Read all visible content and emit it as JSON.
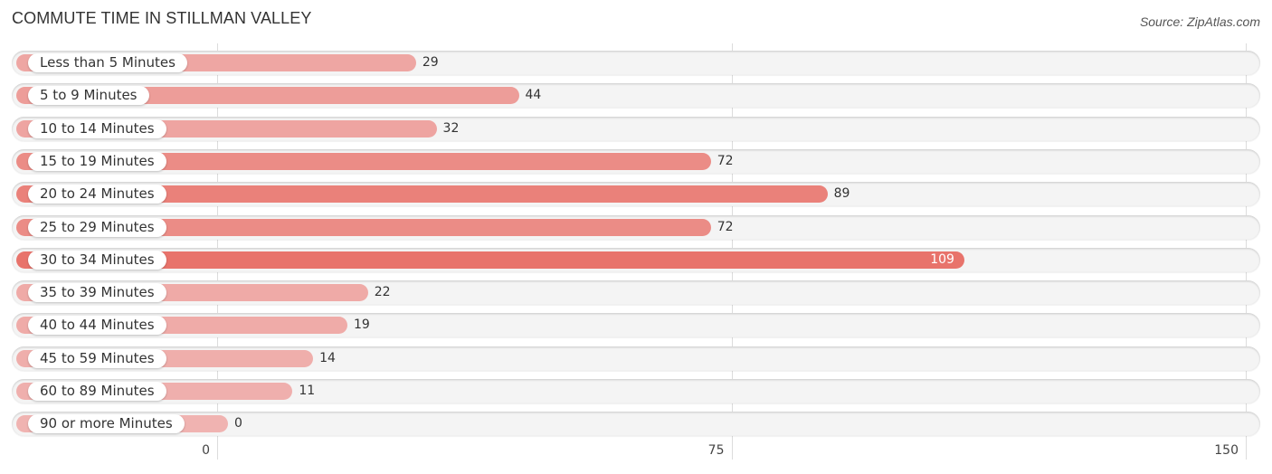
{
  "header": {
    "title": "COMMUTE TIME IN STILLMAN VALLEY",
    "source": "Source: ZipAtlas.com"
  },
  "chart_data": {
    "type": "bar",
    "orientation": "horizontal",
    "title": "COMMUTE TIME IN STILLMAN VALLEY",
    "xlabel": "",
    "ylabel": "",
    "categories": [
      "Less than 5 Minutes",
      "5 to 9 Minutes",
      "10 to 14 Minutes",
      "15 to 19 Minutes",
      "20 to 24 Minutes",
      "25 to 29 Minutes",
      "30 to 34 Minutes",
      "35 to 39 Minutes",
      "40 to 44 Minutes",
      "45 to 59 Minutes",
      "60 to 89 Minutes",
      "90 or more Minutes"
    ],
    "values": [
      29,
      44,
      32,
      72,
      89,
      72,
      109,
      22,
      19,
      14,
      11,
      0
    ],
    "value_labels": [
      "29",
      "44",
      "32",
      "72",
      "89",
      "72",
      "109",
      "22",
      "19",
      "14",
      "11",
      "0"
    ],
    "xlim": [
      0,
      150
    ],
    "xticks": [
      0,
      75,
      150
    ],
    "xtick_labels": [
      "0",
      "75",
      "150"
    ],
    "grid": true,
    "colors": {
      "low": "#F0B3B1",
      "high": "#E8736B"
    },
    "source": "Source: ZipAtlas.com"
  }
}
